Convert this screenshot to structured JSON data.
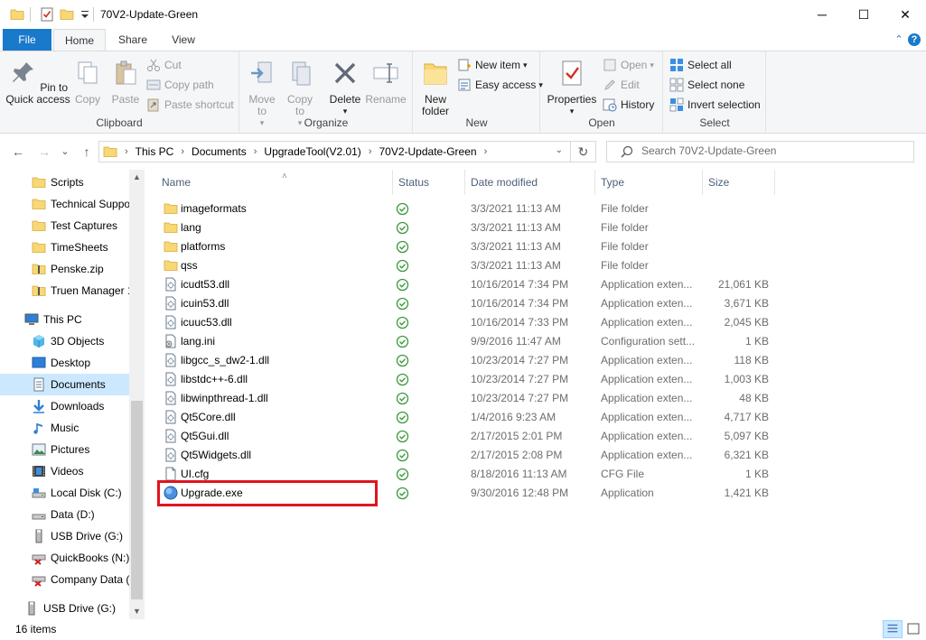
{
  "window": {
    "title": "70V2-Update-Green",
    "minimize_glyph": "─",
    "maximize_glyph": "☐",
    "close_glyph": "✕"
  },
  "tabs": {
    "file": "File",
    "home": "Home",
    "share": "Share",
    "view": "View",
    "collapse_glyph": "⌃",
    "help_glyph": "?"
  },
  "ribbon": {
    "clipboard": {
      "label": "Clipboard",
      "pin": "Pin to Quick access",
      "copy": "Copy",
      "paste": "Paste",
      "cut": "Cut",
      "copy_path": "Copy path",
      "paste_shortcut": "Paste shortcut"
    },
    "organize": {
      "label": "Organize",
      "move_to": "Move to",
      "copy_to": "Copy to",
      "delete": "Delete",
      "rename": "Rename"
    },
    "new": {
      "label": "New",
      "new_folder": "New folder",
      "new_item": "New item",
      "easy_access": "Easy access"
    },
    "open": {
      "label": "Open",
      "properties": "Properties",
      "open": "Open",
      "edit": "Edit",
      "history": "History"
    },
    "select": {
      "label": "Select",
      "select_all": "Select all",
      "select_none": "Select none",
      "invert_selection": "Invert selection"
    }
  },
  "address": {
    "back_glyph": "←",
    "forward_glyph": "→",
    "recent_glyph": "⌄",
    "up_glyph": "↑",
    "crumbs": [
      "This PC",
      "Documents",
      "UpgradeTool(V2.01)",
      "70V2-Update-Green"
    ],
    "crumb_sep": "›",
    "dropdown_glyph": "⌄",
    "refresh_glyph": "↻",
    "search_placeholder": "Search 70V2-Update-Green"
  },
  "navpane": {
    "items": [
      {
        "label": "Scripts",
        "icon": "folder-icon"
      },
      {
        "label": "Technical Suppo",
        "icon": "folder-icon"
      },
      {
        "label": "Test Captures",
        "icon": "folder-icon"
      },
      {
        "label": "TimeSheets",
        "icon": "folder-icon"
      },
      {
        "label": "Penske.zip",
        "icon": "zip-folder-icon"
      },
      {
        "label": "Truen Manager 1",
        "icon": "zip-folder-icon"
      },
      {
        "label": "This PC",
        "icon": "computer-icon"
      },
      {
        "label": "3D Objects",
        "icon": "cube-icon"
      },
      {
        "label": "Desktop",
        "icon": "desktop-icon"
      },
      {
        "label": "Documents",
        "icon": "documents-icon"
      },
      {
        "label": "Downloads",
        "icon": "download-icon"
      },
      {
        "label": "Music",
        "icon": "music-icon"
      },
      {
        "label": "Pictures",
        "icon": "pictures-icon"
      },
      {
        "label": "Videos",
        "icon": "videos-icon"
      },
      {
        "label": "Local Disk (C:)",
        "icon": "local-disk-icon"
      },
      {
        "label": "Data (D:)",
        "icon": "drive-icon"
      },
      {
        "label": "USB Drive (G:)",
        "icon": "usb-drive-icon"
      },
      {
        "label": "QuickBooks (N:)",
        "icon": "network-drive-disconnected-icon"
      },
      {
        "label": "Company Data (",
        "icon": "network-drive-disconnected-icon"
      },
      {
        "label": "USB Drive (G:)",
        "icon": "usb-drive-icon"
      }
    ],
    "selected": "Documents",
    "scroll_up_glyph": "▲",
    "scroll_down_glyph": "▼"
  },
  "columns": {
    "name": "Name",
    "status": "Status",
    "date": "Date modified",
    "type": "Type",
    "size": "Size",
    "sort_glyph": "˄"
  },
  "files": [
    {
      "name": "imageformats",
      "date": "3/3/2021 11:13 AM",
      "type": "File folder",
      "size": "",
      "icon": "folder-icon"
    },
    {
      "name": "lang",
      "date": "3/3/2021 11:13 AM",
      "type": "File folder",
      "size": "",
      "icon": "folder-icon"
    },
    {
      "name": "platforms",
      "date": "3/3/2021 11:13 AM",
      "type": "File folder",
      "size": "",
      "icon": "folder-icon"
    },
    {
      "name": "qss",
      "date": "3/3/2021 11:13 AM",
      "type": "File folder",
      "size": "",
      "icon": "folder-icon"
    },
    {
      "name": "icudt53.dll",
      "date": "10/16/2014 7:34 PM",
      "type": "Application exten...",
      "size": "21,061 KB",
      "icon": "dll-file-icon"
    },
    {
      "name": "icuin53.dll",
      "date": "10/16/2014 7:34 PM",
      "type": "Application exten...",
      "size": "3,671 KB",
      "icon": "dll-file-icon"
    },
    {
      "name": "icuuc53.dll",
      "date": "10/16/2014 7:33 PM",
      "type": "Application exten...",
      "size": "2,045 KB",
      "icon": "dll-file-icon"
    },
    {
      "name": "lang.ini",
      "date": "9/9/2016 11:47 AM",
      "type": "Configuration sett...",
      "size": "1 KB",
      "icon": "settings-file-icon"
    },
    {
      "name": "libgcc_s_dw2-1.dll",
      "date": "10/23/2014 7:27 PM",
      "type": "Application exten...",
      "size": "118 KB",
      "icon": "dll-file-icon"
    },
    {
      "name": "libstdc++-6.dll",
      "date": "10/23/2014 7:27 PM",
      "type": "Application exten...",
      "size": "1,003 KB",
      "icon": "dll-file-icon"
    },
    {
      "name": "libwinpthread-1.dll",
      "date": "10/23/2014 7:27 PM",
      "type": "Application exten...",
      "size": "48 KB",
      "icon": "dll-file-icon"
    },
    {
      "name": "Qt5Core.dll",
      "date": "1/4/2016 9:23 AM",
      "type": "Application exten...",
      "size": "4,717 KB",
      "icon": "dll-file-icon"
    },
    {
      "name": "Qt5Gui.dll",
      "date": "2/17/2015 2:01 PM",
      "type": "Application exten...",
      "size": "5,097 KB",
      "icon": "dll-file-icon"
    },
    {
      "name": "Qt5Widgets.dll",
      "date": "2/17/2015 2:08 PM",
      "type": "Application exten...",
      "size": "6,321 KB",
      "icon": "dll-file-icon"
    },
    {
      "name": "UI.cfg",
      "date": "8/18/2016 11:13 AM",
      "type": "CFG File",
      "size": "1 KB",
      "icon": "blank-file-icon"
    },
    {
      "name": "Upgrade.exe",
      "date": "9/30/2016 12:48 PM",
      "type": "Application",
      "size": "1,421 KB",
      "icon": "app-globe-icon"
    }
  ],
  "highlighted_file": "Upgrade.exe",
  "statusbar": {
    "item_count": "16 items"
  },
  "colors": {
    "accent": "#1979ca",
    "selection": "#cce8ff",
    "highlight_box": "#e0141e",
    "sync_ok": "#3a9a3a",
    "folder": "#f8d775"
  }
}
